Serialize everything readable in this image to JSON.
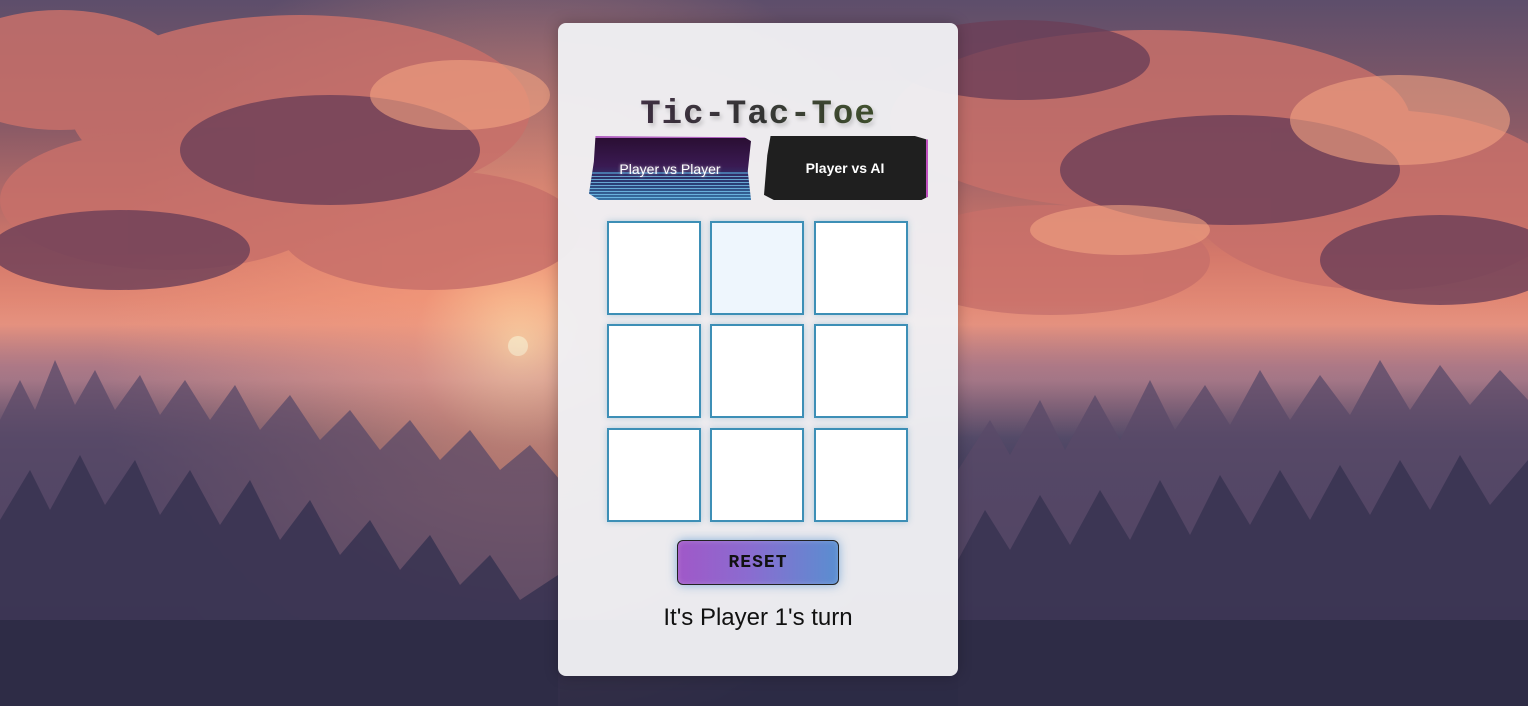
{
  "game": {
    "title": "Tic-Tac-Toe",
    "modes": [
      {
        "label": "Player vs Player",
        "active": true
      },
      {
        "label": "Player vs AI",
        "active": false
      }
    ],
    "board": [
      "",
      "",
      "",
      "",
      "",
      "",
      "",
      "",
      ""
    ],
    "reset_label": "RESET",
    "status": "It's Player 1's turn"
  },
  "colors": {
    "cell_border": "#3d8fb6",
    "panel_bg": "#f0f0f3",
    "ai_button_bg": "#1f1f1f"
  }
}
